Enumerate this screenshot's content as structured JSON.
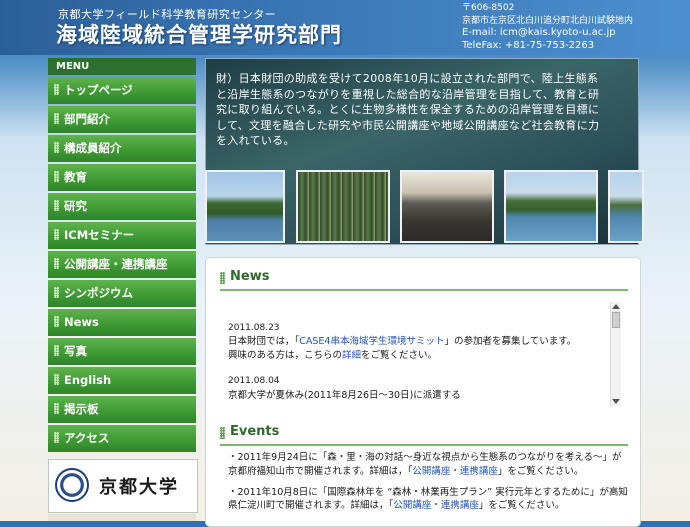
{
  "header": {
    "subtitle": "京都大学フィールド科学教育研究センター",
    "title": "海域陸域統合管理学研究部門",
    "contact": {
      "postal": "〒606-8502",
      "address": "京都市左京区北白川追分町北白川試験地内",
      "email": "E-mail: icm@kais.kyoto-u.ac.jp",
      "fax": "TeleFax: +81-75-753-2263"
    }
  },
  "sidebar": {
    "menu_label": "MENU",
    "items": [
      {
        "label": "トップページ"
      },
      {
        "label": "部門紹介"
      },
      {
        "label": "構成員紹介"
      },
      {
        "label": "教育"
      },
      {
        "label": "研究"
      },
      {
        "label": "ICMセミナー"
      },
      {
        "label": "公開講座・連携講座"
      },
      {
        "label": "シンポジウム"
      },
      {
        "label": "News"
      },
      {
        "label": "写真"
      },
      {
        "label": "English"
      },
      {
        "label": "掲示板"
      },
      {
        "label": "アクセス"
      }
    ],
    "logo_text": "京都大学"
  },
  "banner": {
    "text": "財）日本財団の助成を受けて2008年10月に設立された部門で、陸上生態系と沿岸生態系のつながりを重視した総合的な沿岸管理を目指して、教育と研究に取り組んでいる。とくに生物多様性を保全するための沿岸管理を目標にして、文理を融合した研究や市民公開講座や地域公開講座など社会教育に力を入れている。"
  },
  "news": {
    "heading": "News",
    "items": [
      {
        "date": "2011.08.23",
        "line1_pre": "日本財団では，「",
        "link": "CASE4串本海域学生環境サミット",
        "line1_post": "」の参加者を募集しています。",
        "line2_pre": "興味のある方は，こちらの",
        "line2_link": "詳細",
        "line2_post": "をご覧ください。"
      },
      {
        "date": "2011.08.04",
        "text": "京都大学が夏休み(2011年8月26日～30日)に派遣する"
      }
    ]
  },
  "events": {
    "heading": "Events",
    "items": [
      {
        "pre": "・2011年9月24日に「森・里・海の対話～身近な視点から生態系のつながりを考える～」が京都府福知山市で開催されます。詳細は，「",
        "link": "公開講座・連携講座",
        "post": "」をご覧ください。"
      },
      {
        "pre": "・2011年10月8日に「国際森林年を “森林・林業再生プラン” 実行元年とするために」が高知県仁淀川町で開催されます。詳細は，「",
        "link": "公開講座・連携講座",
        "post": "」をご覧ください。"
      }
    ]
  }
}
